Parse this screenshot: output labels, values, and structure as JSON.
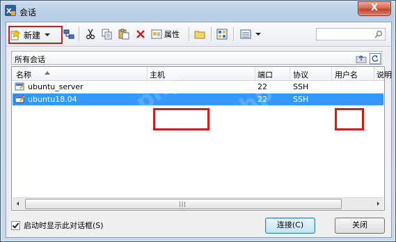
{
  "window": {
    "title": "会话",
    "close_symbol": "X"
  },
  "toolbar": {
    "new_label": "新建",
    "properties_label": "属性",
    "search_placeholder": ""
  },
  "pathbar": {
    "label": "所有会话"
  },
  "table": {
    "headers": {
      "name": "名称",
      "host": "主机",
      "port": "端口",
      "protocol": "协议",
      "username": "用户名",
      "description": "说明"
    },
    "rows": [
      {
        "name": "ubuntu_server",
        "host": "",
        "port": "22",
        "protocol": "SSH",
        "username": "",
        "selected": false
      },
      {
        "name": "ubuntu18.04",
        "host": "",
        "port": "22",
        "protocol": "SSH",
        "username": "",
        "selected": true
      }
    ]
  },
  "footer": {
    "startup_checkbox_label": "启动时显示此对话框(S)",
    "startup_checked": true,
    "connect_label": "连接(C)",
    "close_label": "关闭"
  },
  "colors": {
    "selection": "#3399ff",
    "highlight_box": "#d01c1c"
  }
}
